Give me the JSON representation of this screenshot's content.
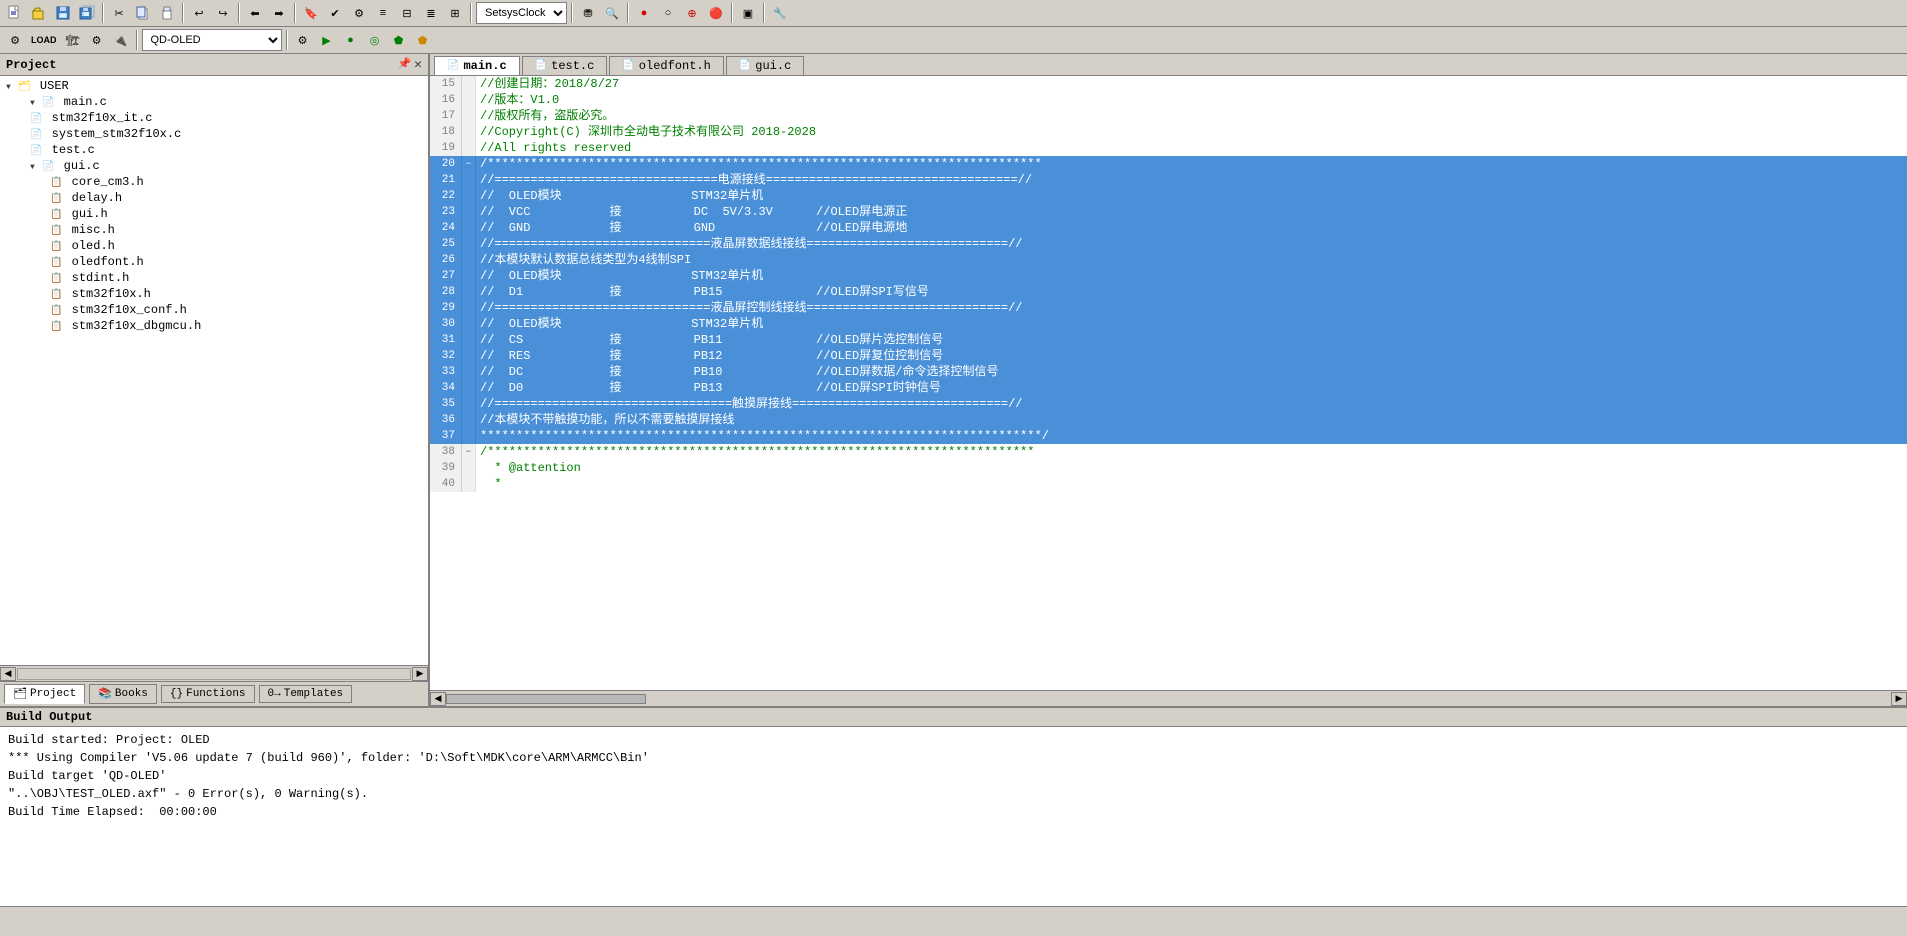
{
  "toolbar1": {
    "buttons": [
      "📄",
      "📂",
      "💾",
      "🖨",
      "✂",
      "📋",
      "📌",
      "↩",
      "↪",
      "⬅",
      "➡",
      "🔖",
      "🔗",
      "📎",
      "📏",
      "📐",
      "🔍",
      "⚙",
      "▶",
      "⏹",
      "🔴",
      "⭕",
      "🔗",
      "🏷",
      "🔧"
    ]
  },
  "toolbar2": {
    "target_label": "QD-OLED",
    "buttons": [
      "⚙",
      "📦",
      "🏗",
      "▶",
      "⏹",
      "🔧",
      "⚡",
      "🔥"
    ]
  },
  "project_panel": {
    "title": "Project",
    "root": "USER",
    "files": [
      "main.c",
      "stm32f10x_it.c",
      "system_stm32f10x.c",
      "test.c",
      "gui.c",
      "core_cm3.h",
      "delay.h",
      "gui.h",
      "misc.h",
      "oled.h",
      "oledfont.h",
      "stdint.h",
      "stm32f10x.h",
      "stm32f10x_conf.h",
      "stm32f10x_dbgmcu.h"
    ],
    "tabs": [
      {
        "id": "project",
        "label": "Project",
        "active": true
      },
      {
        "id": "books",
        "label": "Books"
      },
      {
        "id": "functions",
        "label": "Functions"
      },
      {
        "id": "templates",
        "label": "Templates"
      }
    ]
  },
  "code_editor": {
    "tabs": [
      {
        "id": "main_c",
        "label": "main.c",
        "active": true,
        "icon": "📄"
      },
      {
        "id": "test_c",
        "label": "test.c",
        "active": false,
        "icon": "📄"
      },
      {
        "id": "oledfont_h",
        "label": "oledfont.h",
        "active": false,
        "icon": "📄"
      },
      {
        "id": "gui_c",
        "label": "gui.c",
        "active": false,
        "icon": "📄"
      }
    ],
    "lines": [
      {
        "num": 15,
        "fold": false,
        "content": "//创建日期：2018/8/27",
        "color": "comment",
        "selected": false
      },
      {
        "num": 16,
        "fold": false,
        "content": "//版本：V1.0",
        "color": "comment",
        "selected": false
      },
      {
        "num": 17,
        "fold": false,
        "content": "//版权所有，盗版必究。",
        "color": "comment",
        "selected": false
      },
      {
        "num": 18,
        "fold": false,
        "content": "//Copyright(C) 深圳市全动电子技术有限公司 2018-2028",
        "color": "comment",
        "selected": false
      },
      {
        "num": 19,
        "fold": false,
        "content": "//All rights reserved",
        "color": "comment",
        "selected": false
      },
      {
        "num": 20,
        "fold": true,
        "content": "/*****************************************************************************",
        "color": "comment",
        "selected": true
      },
      {
        "num": 21,
        "fold": false,
        "content": "//===============================电源接线===================================//",
        "color": "comment",
        "selected": true
      },
      {
        "num": 22,
        "fold": false,
        "content": "//  OLED模块                  STM32单片机",
        "color": "comment",
        "selected": true
      },
      {
        "num": 23,
        "fold": false,
        "content": "//  VCC           接          DC  5V/3.3V      //OLED屏电源正",
        "color": "comment",
        "selected": true
      },
      {
        "num": 24,
        "fold": false,
        "content": "//  GND           接          GND              //OLED屏电源地",
        "color": "comment",
        "selected": true
      },
      {
        "num": 25,
        "fold": false,
        "content": "//==============================液晶屏数据线接线============================//",
        "color": "comment",
        "selected": true
      },
      {
        "num": 26,
        "fold": false,
        "content": "//本模块默认数据总线类型为4线制SPI",
        "color": "comment",
        "selected": true
      },
      {
        "num": 27,
        "fold": false,
        "content": "//  OLED模块                  STM32单片机",
        "color": "comment",
        "selected": true
      },
      {
        "num": 28,
        "fold": false,
        "content": "//  D1            接          PB15             //OLED屏SPI写信号",
        "color": "comment",
        "selected": true
      },
      {
        "num": 29,
        "fold": false,
        "content": "//==============================液晶屏控制线接线============================//",
        "color": "comment",
        "selected": true
      },
      {
        "num": 30,
        "fold": false,
        "content": "//  OLED模块                  STM32单片机",
        "color": "comment",
        "selected": true
      },
      {
        "num": 31,
        "fold": false,
        "content": "//  CS            接          PB11             //OLED屏片选控制信号",
        "color": "comment",
        "selected": true
      },
      {
        "num": 32,
        "fold": false,
        "content": "//  RES           接          PB12             //OLED屏复位控制信号",
        "color": "comment",
        "selected": true
      },
      {
        "num": 33,
        "fold": false,
        "content": "//  DC            接          PB10             //OLED屏数据/命令选择控制信号",
        "color": "comment",
        "selected": true
      },
      {
        "num": 34,
        "fold": false,
        "content": "//  D0            接          PB13             //OLED屏SPI时钟信号",
        "color": "comment",
        "selected": true
      },
      {
        "num": 35,
        "fold": false,
        "content": "//=================================触摸屏接线==============================//",
        "color": "comment",
        "selected": true
      },
      {
        "num": 36,
        "fold": false,
        "content": "//本模块不带触摸功能，所以不需要触摸屏接线",
        "color": "comment",
        "selected": true
      },
      {
        "num": 37,
        "fold": false,
        "content": "******************************************************************************/",
        "color": "comment",
        "selected": true
      },
      {
        "num": 38,
        "fold": true,
        "content": "/****************************************************************************",
        "color": "comment",
        "selected": false
      },
      {
        "num": 39,
        "fold": false,
        "content": "  * @attention",
        "color": "comment",
        "selected": false
      },
      {
        "num": 40,
        "fold": false,
        "content": "  *",
        "color": "comment",
        "selected": false
      }
    ]
  },
  "build_output": {
    "title": "Build Output",
    "lines": [
      "Build started: Project: OLED",
      "*** Using Compiler 'V5.06 update 7 (build 960)', folder: 'D:\\Soft\\MDK\\core\\ARM\\ARMCC\\Bin'",
      "Build target 'QD-OLED'",
      "\"..\\OBJ\\TEST_OLED.axf\" - 0 Error(s), 0 Warning(s).",
      "Build Time Elapsed:  00:00:00"
    ]
  }
}
